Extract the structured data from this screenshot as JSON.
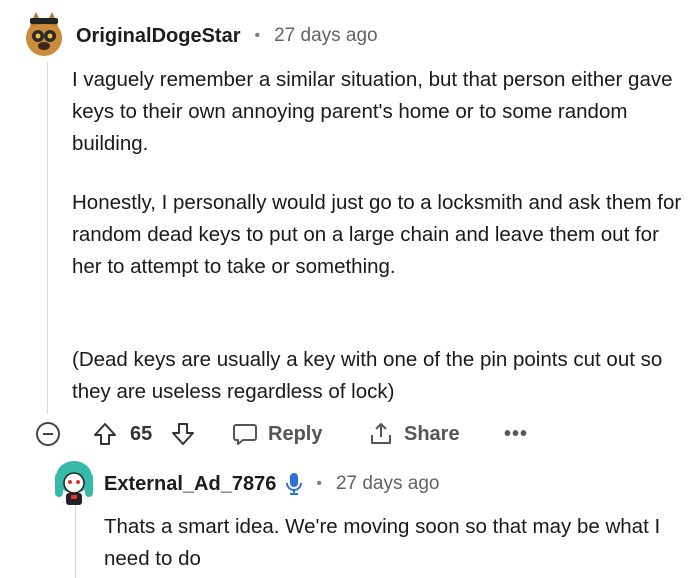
{
  "comment": {
    "username": "OriginalDogeStar",
    "separator": "•",
    "timestamp": "27 days ago",
    "paragraphs": [
      "I vaguely remember a similar situation, but that person either gave keys to their own annoying parent's home or to some random building.",
      "Honestly, I personally would just go to a locksmith and ask them for random dead keys to put on a large chain and leave them out for her to attempt to take or something.",
      "(Dead keys are usually a key with one of the pin points cut out so they are useless regardless of lock)"
    ],
    "actions": {
      "vote_count": "65",
      "reply_label": "Reply",
      "share_label": "Share",
      "more_label": "•••"
    },
    "avatar_icon": "doge-avatar-icon"
  },
  "reply": {
    "username": "External_Ad_7876",
    "separator": "•",
    "timestamp": "27 days ago",
    "text": "Thats a smart idea. We're moving soon so that may be what I need to do",
    "avatar_icon": "teal-hair-avatar-icon",
    "badge_icon": "microphone-icon"
  },
  "colors": {
    "text": "#1a1a1b",
    "meta": "#5f6368",
    "badge_blue": "#2f6fd6"
  }
}
